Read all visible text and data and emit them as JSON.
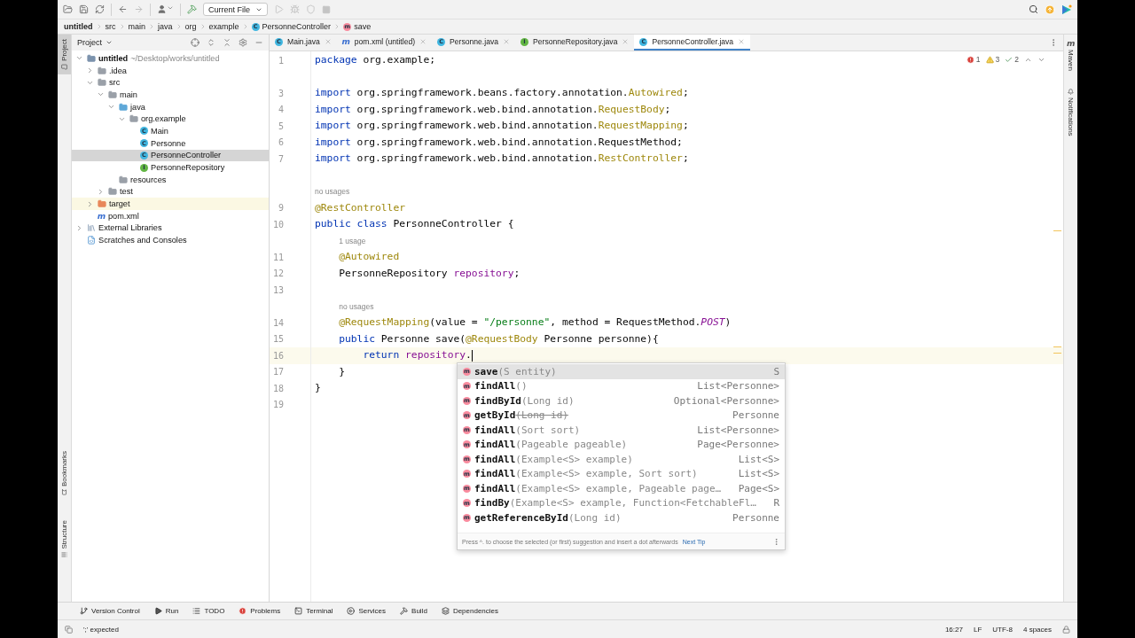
{
  "toolbar": {
    "run_config": "Current File"
  },
  "breadcrumbs": [
    {
      "label": "untitled",
      "kind": "project"
    },
    {
      "label": "src",
      "kind": "folder"
    },
    {
      "label": "main",
      "kind": "folder"
    },
    {
      "label": "java",
      "kind": "folder"
    },
    {
      "label": "org",
      "kind": "folder"
    },
    {
      "label": "example",
      "kind": "folder"
    },
    {
      "label": "PersonneController",
      "kind": "class",
      "badge": "C"
    },
    {
      "label": "save",
      "kind": "method",
      "badge": "m"
    }
  ],
  "left_stripe": [
    {
      "label": "Project",
      "selected": true
    },
    {
      "label": "Bookmarks",
      "selected": false
    },
    {
      "label": "Structure",
      "selected": false
    }
  ],
  "project_panel": {
    "title": "Project",
    "tree": [
      {
        "label": "untitled",
        "kind": "module",
        "note": "~/Desktop/works/untitled",
        "expanded": true,
        "selected": false,
        "children": [
          {
            "label": ".idea",
            "kind": "folder",
            "expanded": false,
            "selected": false
          },
          {
            "label": "src",
            "kind": "folder",
            "expanded": true,
            "selected": false,
            "children": [
              {
                "label": "main",
                "kind": "folder",
                "expanded": true,
                "selected": false,
                "children": [
                  {
                    "label": "java",
                    "kind": "source",
                    "expanded": true,
                    "selected": false,
                    "children": [
                      {
                        "label": "org.example",
                        "kind": "package",
                        "expanded": true,
                        "selected": false,
                        "children": [
                          {
                            "label": "Main",
                            "kind": "class",
                            "badge": "C",
                            "selected": false
                          },
                          {
                            "label": "Personne",
                            "kind": "class",
                            "badge": "C",
                            "selected": false
                          },
                          {
                            "label": "PersonneController",
                            "kind": "class",
                            "badge": "C",
                            "selected": true
                          },
                          {
                            "label": "PersonneRepository",
                            "kind": "interface",
                            "badge": "I",
                            "selected": false
                          }
                        ]
                      }
                    ]
                  },
                  {
                    "label": "resources",
                    "kind": "resources",
                    "selected": false
                  }
                ]
              },
              {
                "label": "test",
                "kind": "folder",
                "expanded": false,
                "selected": false
              }
            ]
          },
          {
            "label": "target",
            "kind": "excluded",
            "expanded": false,
            "selected": false
          },
          {
            "label": "pom.xml",
            "kind": "maven",
            "badge": "m",
            "selected": false
          }
        ]
      },
      {
        "label": "External Libraries",
        "kind": "library",
        "expanded": false,
        "selected": false
      },
      {
        "label": "Scratches and Consoles",
        "kind": "scratches",
        "selected": false
      }
    ]
  },
  "tabs": [
    {
      "label": "Main.java",
      "kind": "class",
      "badge": "C",
      "selected": false
    },
    {
      "label": "pom.xml (untitled)",
      "kind": "maven",
      "badge": "m",
      "selected": false
    },
    {
      "label": "Personne.java",
      "kind": "class",
      "badge": "C",
      "selected": false
    },
    {
      "label": "PersonneRepository.java",
      "kind": "interface",
      "badge": "I",
      "selected": false
    },
    {
      "label": "PersonneController.java",
      "kind": "class",
      "badge": "C",
      "selected": true
    }
  ],
  "inspections": {
    "errors": "1",
    "warnings": "3",
    "typos": "2"
  },
  "editor": {
    "lines": [
      {
        "kind": "code",
        "number": "1",
        "tokens": [
          {
            "kind": "kw",
            "text": "package"
          },
          {
            "kind": "plain",
            "text": " org.example;"
          }
        ]
      },
      {
        "kind": "code"
      },
      {
        "kind": "code",
        "number": "3",
        "tokens": [
          {
            "kind": "kw",
            "text": "import"
          },
          {
            "kind": "plain",
            "text": " org.springframework.beans.factory.annotation."
          },
          {
            "kind": "ann",
            "text": "Autowired"
          },
          {
            "kind": "plain",
            "text": ";"
          }
        ]
      },
      {
        "kind": "code",
        "number": "4",
        "tokens": [
          {
            "kind": "kw",
            "text": "import"
          },
          {
            "kind": "plain",
            "text": " org.springframework.web.bind.annotation."
          },
          {
            "kind": "ann",
            "text": "RequestBody"
          },
          {
            "kind": "plain",
            "text": ";"
          }
        ]
      },
      {
        "kind": "code",
        "number": "5",
        "tokens": [
          {
            "kind": "kw",
            "text": "import"
          },
          {
            "kind": "plain",
            "text": " org.springframework.web.bind.annotation."
          },
          {
            "kind": "ann",
            "text": "RequestMapping"
          },
          {
            "kind": "plain",
            "text": ";"
          }
        ]
      },
      {
        "kind": "code",
        "number": "6",
        "tokens": [
          {
            "kind": "kw",
            "text": "import"
          },
          {
            "kind": "plain",
            "text": " org.springframework.web.bind.annotation.RequestMethod;"
          }
        ]
      },
      {
        "kind": "code",
        "number": "7",
        "tokens": [
          {
            "kind": "kw",
            "text": "import"
          },
          {
            "kind": "plain",
            "text": " org.springframework.web.bind.annotation."
          },
          {
            "kind": "ann",
            "text": "RestController"
          },
          {
            "kind": "plain",
            "text": ";"
          }
        ]
      },
      {
        "kind": "code"
      },
      {
        "kind": "hint",
        "text": "no usages"
      },
      {
        "kind": "code",
        "number": "9",
        "tokens": [
          {
            "kind": "ann",
            "text": "@RestController"
          }
        ]
      },
      {
        "kind": "code",
        "number": "10",
        "tokens": [
          {
            "kind": "kw",
            "text": "public class"
          },
          {
            "kind": "plain",
            "text": " PersonneController {"
          }
        ]
      },
      {
        "kind": "hint",
        "text": "1 usage"
      },
      {
        "kind": "code",
        "number": "11",
        "tokens": [
          {
            "kind": "ann",
            "text": "    @Autowired"
          }
        ]
      },
      {
        "kind": "code",
        "number": "12",
        "tokens": [
          {
            "kind": "plain",
            "text": "    PersonneRepository "
          },
          {
            "kind": "field",
            "text": "repository"
          },
          {
            "kind": "plain",
            "text": ";"
          }
        ]
      },
      {
        "kind": "code",
        "number": "13"
      },
      {
        "kind": "hint",
        "text": "no usages"
      },
      {
        "kind": "code",
        "number": "14",
        "tokens": [
          {
            "kind": "ann",
            "text": "    @RequestMapping"
          },
          {
            "kind": "plain",
            "text": "(value = "
          },
          {
            "kind": "str",
            "text": "\"/personne\""
          },
          {
            "kind": "plain",
            "text": ", method = RequestMethod."
          },
          {
            "kind": "const",
            "text": "POST"
          },
          {
            "kind": "plain",
            "text": ")"
          }
        ]
      },
      {
        "kind": "code",
        "number": "15",
        "tokens": [
          {
            "kind": "kw",
            "text": "    public"
          },
          {
            "kind": "plain",
            "text": " Personne save("
          },
          {
            "kind": "ann",
            "text": "@RequestBody"
          },
          {
            "kind": "plain",
            "text": " Personne personne){"
          }
        ]
      },
      {
        "kind": "code",
        "number": "16",
        "current": true,
        "caret": true,
        "tokens": [
          {
            "kind": "kw",
            "text": "        return "
          },
          {
            "kind": "field",
            "text": "repository"
          },
          {
            "kind": "plain",
            "text": "."
          }
        ]
      },
      {
        "kind": "code",
        "number": "17",
        "tokens": [
          {
            "kind": "plain",
            "text": "    }"
          }
        ]
      },
      {
        "kind": "code",
        "number": "18",
        "tokens": [
          {
            "kind": "plain",
            "text": "}"
          }
        ]
      },
      {
        "kind": "code",
        "number": "19"
      }
    ]
  },
  "completion": {
    "items": [
      {
        "badge": "m",
        "name": "save",
        "params": "(S entity)",
        "type": "S",
        "deprecated": false,
        "selected": true
      },
      {
        "badge": "m",
        "name": "findAll",
        "params": "()",
        "type": "List<Personne>",
        "deprecated": false,
        "selected": false
      },
      {
        "badge": "m",
        "name": "findById",
        "params": "(Long id)",
        "type": "Optional<Personne>",
        "deprecated": false,
        "selected": false
      },
      {
        "badge": "m",
        "name": "getById",
        "params": "(Long id)",
        "type": "Personne",
        "deprecated": true,
        "selected": false
      },
      {
        "badge": "m",
        "name": "findAll",
        "params": "(Sort sort)",
        "type": "List<Personne>",
        "deprecated": false,
        "selected": false
      },
      {
        "badge": "m",
        "name": "findAll",
        "params": "(Pageable pageable)",
        "type": "Page<Personne>",
        "deprecated": false,
        "selected": false
      },
      {
        "badge": "m",
        "name": "findAll",
        "params": "(Example<S> example)",
        "type": "List<S>",
        "deprecated": false,
        "selected": false
      },
      {
        "badge": "m",
        "name": "findAll",
        "params": "(Example<S> example, Sort sort)",
        "type": "List<S>",
        "deprecated": false,
        "selected": false
      },
      {
        "badge": "m",
        "name": "findAll",
        "params": "(Example<S> example, Pageable page…",
        "type": "Page<S>",
        "deprecated": false,
        "selected": false
      },
      {
        "badge": "m",
        "name": "findBy",
        "params": "(Example<S> example, Function<FetchableFl…",
        "type": "R",
        "deprecated": false,
        "selected": false
      },
      {
        "badge": "m",
        "name": "getReferenceById",
        "params": "(Long id)",
        "type": "Personne",
        "deprecated": false,
        "selected": false
      }
    ],
    "hint": "Press ^. to choose the selected (or first) suggestion and insert a dot afterwards",
    "link": "Next Tip"
  },
  "right_stripe": [
    {
      "label": "Maven",
      "badge": "m"
    },
    {
      "label": "Notifications"
    }
  ],
  "tool_windows": [
    {
      "label": "Version Control",
      "kind": "vcs"
    },
    {
      "label": "Run",
      "kind": "run"
    },
    {
      "label": "TODO",
      "kind": "todo"
    },
    {
      "label": "Problems",
      "kind": "problems"
    },
    {
      "label": "Terminal",
      "kind": "terminal"
    },
    {
      "label": "Services",
      "kind": "services"
    },
    {
      "label": "Build",
      "kind": "build"
    },
    {
      "label": "Dependencies",
      "kind": "dependencies"
    }
  ],
  "status_bar": {
    "message": "';' expected",
    "items": [
      "16:27",
      "LF",
      "UTF-8",
      "4 spaces"
    ]
  }
}
